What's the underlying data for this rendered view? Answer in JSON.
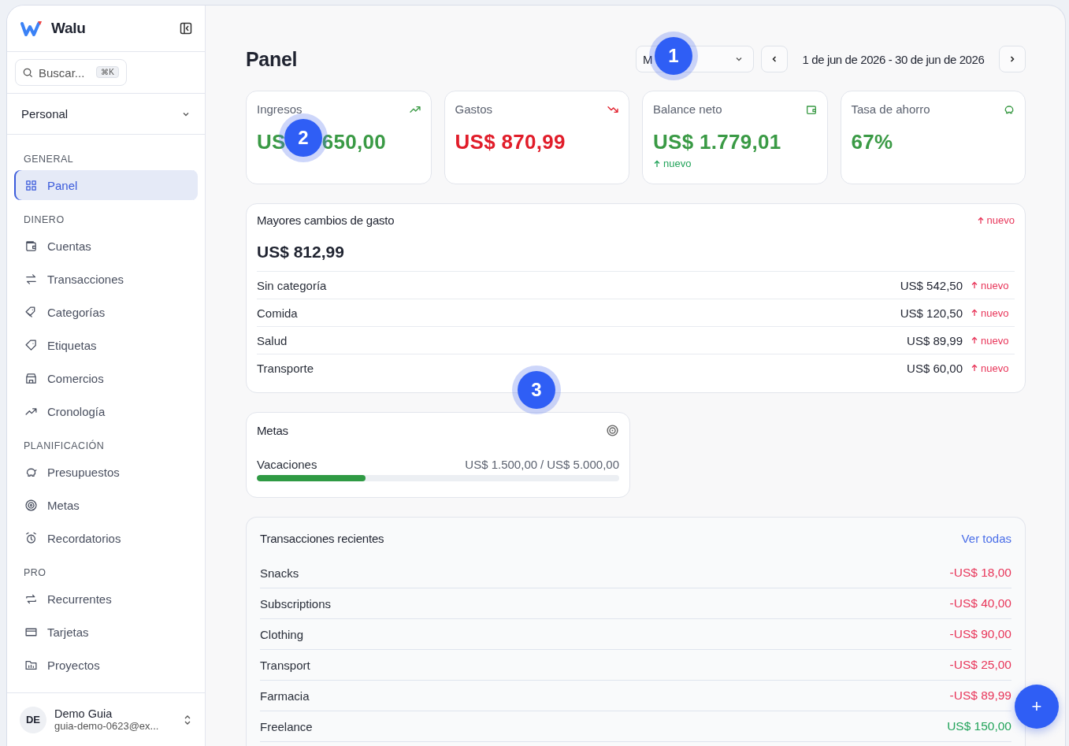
{
  "sidebar": {
    "brand": "Walu",
    "search": {
      "placeholder": "Buscar...",
      "shortcut": "⌘K"
    },
    "workspace": "Personal",
    "sections": [
      {
        "title": "GENERAL",
        "items": [
          {
            "label": "Panel",
            "selected": true
          }
        ]
      },
      {
        "title": "DINERO",
        "items": [
          {
            "label": "Cuentas",
            "selected": false
          },
          {
            "label": "Transacciones",
            "selected": false
          },
          {
            "label": "Categorías",
            "selected": false
          },
          {
            "label": "Etiquetas",
            "selected": false
          },
          {
            "label": "Comercios",
            "selected": false
          },
          {
            "label": "Cronología",
            "selected": false
          }
        ]
      },
      {
        "title": "PLANIFICACIÓN",
        "items": [
          {
            "label": "Presupuestos",
            "selected": false
          },
          {
            "label": "Metas",
            "selected": false
          },
          {
            "label": "Recordatorios",
            "selected": false
          }
        ]
      },
      {
        "title": "PRO",
        "items": [
          {
            "label": "Recurrentes",
            "selected": false
          },
          {
            "label": "Tarjetas",
            "selected": false
          },
          {
            "label": "Proyectos",
            "selected": false
          }
        ]
      }
    ],
    "user": {
      "initials": "DE",
      "name": "Demo Guia",
      "email": "guia-demo-0623@ex..."
    }
  },
  "header": {
    "title": "Panel",
    "period": "M",
    "date_range": "1 de jun de 2026 - 30 de jun de 2026"
  },
  "stats": [
    {
      "label": "Ingresos",
      "value": "US",
      "value_tail": "650,00",
      "color": "#3a9a45"
    },
    {
      "label": "Gastos",
      "value": "US$ 870,99",
      "color": "#e11d2a"
    },
    {
      "label": "Balance neto",
      "value": "US$ 1.779,01",
      "color": "#3a9a45",
      "change": "nuevo"
    },
    {
      "label": "Tasa de ahorro",
      "value": "67%",
      "color": "#3a9a45"
    }
  ],
  "spending_changes": {
    "title": "Mayores cambios de gasto",
    "badge": "nuevo",
    "total": "US$ 812,99",
    "rows": [
      {
        "category": "Sin categoría",
        "amount": "US$ 542,50",
        "change": "nuevo"
      },
      {
        "category": "Comida",
        "amount": "US$ 120,50",
        "change": "nuevo"
      },
      {
        "category": "Salud",
        "amount": "US$ 89,99",
        "change": "nuevo"
      },
      {
        "category": "Transporte",
        "amount": "US$ 60,00",
        "change": "nuevo"
      }
    ]
  },
  "goals": {
    "title": "Metas",
    "items": [
      {
        "name": "Vacaciones",
        "saved": "US$ 1.500,00",
        "separator": "/",
        "target": "US$ 5.000,00",
        "level": 0.3
      }
    ]
  },
  "recent": {
    "title": "Transacciones recientes",
    "link": "Ver todas",
    "rows": [
      {
        "name": "Snacks",
        "amount": "-US$ 18,00",
        "color": "#e8365a"
      },
      {
        "name": "Subscriptions",
        "amount": "-US$ 40,00",
        "color": "#e8365a"
      },
      {
        "name": "Clothing",
        "amount": "-US$ 90,00",
        "color": "#e8365a"
      },
      {
        "name": "Transport",
        "amount": "-US$ 25,00",
        "color": "#e8365a"
      },
      {
        "name": "Farmacia",
        "amount": "-US$ 89,99",
        "color": "#e8365a"
      },
      {
        "name": "Freelance",
        "amount": "US$ 150,00",
        "color": "#22a35a"
      }
    ]
  },
  "fab": "+",
  "step_markers": [
    "1",
    "2",
    "3"
  ]
}
